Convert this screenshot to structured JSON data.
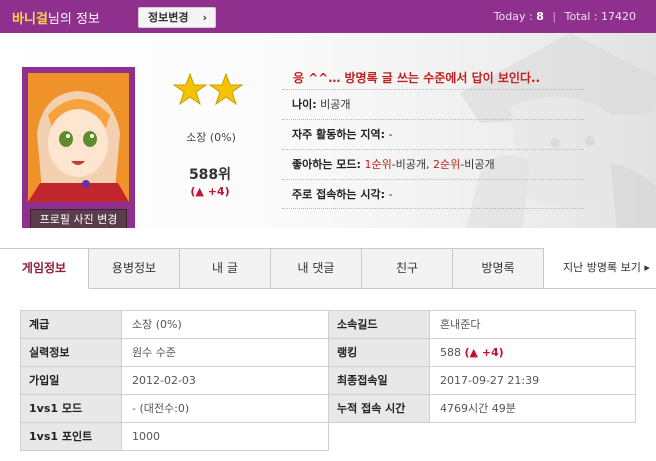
{
  "header": {
    "nickname": "바니걸",
    "nickname_suffix": "님의 정보",
    "edit_button": "정보변경",
    "today_label": "Today :",
    "today_value": "8",
    "total_label": "Total :",
    "total_value": "17420"
  },
  "profile": {
    "photo_button": "프로필 사진 변경",
    "star_count": 2,
    "rank_label": "소장 (0%)",
    "rank_position": "588위",
    "rank_change": "(▲ +4)",
    "motto": "응 ^^… 방명록 글 쓰는 수준에서 답이 보인다..",
    "info": {
      "age_key": "나이:",
      "age_value": "비공개",
      "region_key": "자주 활동하는 지역:",
      "region_value": "-",
      "mode_key": "좋아하는 모드:",
      "mode_first_rank": "1순위",
      "mode_first_value": "-비공개,",
      "mode_second_rank": "2순위",
      "mode_second_value": "-비공개",
      "time_key": "주로 접속하는 시각:",
      "time_value": "-"
    }
  },
  "tabs": [
    "게임정보",
    "용병정보",
    "내 글",
    "내 댓글",
    "친구",
    "방명록"
  ],
  "guestbook_link": "지난 방명록 보기 ▸",
  "details": {
    "rank_key": "계급",
    "rank_value": "소장 (0%)",
    "guild_key": "소속길드",
    "guild_value": "혼내준다",
    "skill_key": "실력정보",
    "skill_value": "원수 수준",
    "ranking_key": "랭킹",
    "ranking_value": "588",
    "ranking_change": "(▲ +4)",
    "join_key": "가입일",
    "join_value": "2012-02-03",
    "last_key": "최종접속일",
    "last_value": "2017-09-27 21:39",
    "mode_key": "1vs1 모드",
    "mode_value": "- (대전수:0)",
    "time_key": "누적 접속 시간",
    "time_value": "4769시간 49분",
    "point_key": "1vs1 포인트",
    "point_value": "1000"
  },
  "colors": {
    "brand_purple": "#8f2f8e",
    "nickname_yellow": "#ffd84a",
    "accent_red": "#c0211e",
    "star_gold": "#f5c400"
  }
}
